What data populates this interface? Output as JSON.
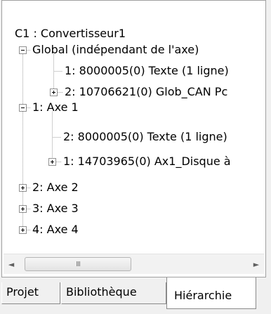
{
  "tree": {
    "root": "C1 : Convertisseur1",
    "global_label": "Global (indépendant de l'axe)",
    "global_items": [
      "1: 8000005(0) Texte (1 ligne)",
      "2: 10706621(0) Glob_CAN Pc"
    ],
    "axe1_label": "1: Axe 1",
    "axe1_items": [
      "2: 8000005(0) Texte (1 ligne)",
      "1: 14703965(0) Ax1_Disque à"
    ],
    "axe2_label": "2: Axe 2",
    "axe3_label": "3: Axe 3",
    "axe4_label": "4: Axe 4"
  },
  "scrollbar": {
    "grip": "III"
  },
  "tabs": [
    "Projet",
    "Bibliothèque",
    "Hiérarchie"
  ],
  "active_tab": "Hiérarchie"
}
